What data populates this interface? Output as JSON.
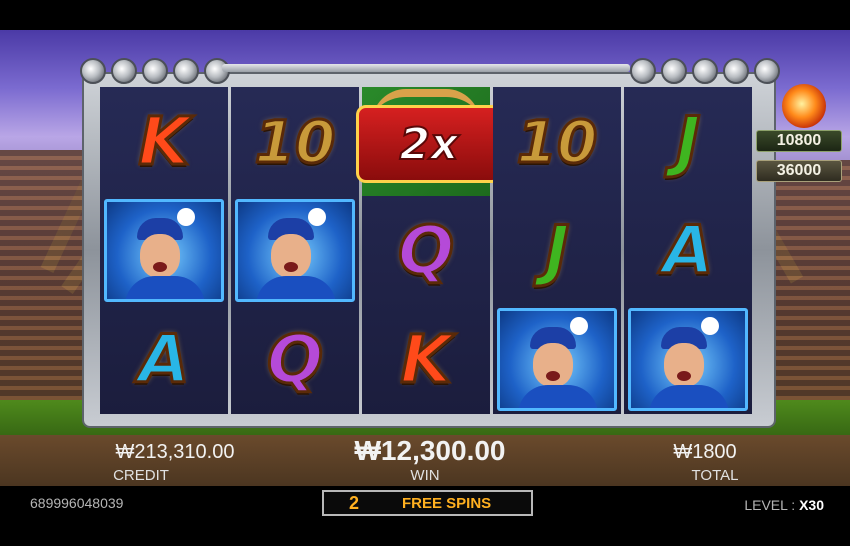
{
  "reels": [
    {
      "symbols": [
        "K",
        "player",
        "A"
      ]
    },
    {
      "symbols": [
        "10",
        "player",
        "Q"
      ]
    },
    {
      "symbols": [
        "multiplier",
        "Q",
        "K"
      ]
    },
    {
      "symbols": [
        "10",
        "J",
        "player"
      ]
    },
    {
      "symbols": [
        "J",
        "A",
        "player"
      ]
    }
  ],
  "multiplier": {
    "label": "2x"
  },
  "jackpots": {
    "top": "10800",
    "second": "36000"
  },
  "hud": {
    "credit_value": "₩213,310.00",
    "credit_label": "CREDIT",
    "win_value": "₩12,300.00",
    "win_label": "WIN",
    "total_value": "₩1800",
    "total_label": "TOTAL"
  },
  "footer": {
    "round_id": "689996048039",
    "free_spins_count": "2",
    "free_spins_label": "FREE SPINS",
    "level_label": "LEVEL :",
    "level_value": "X30"
  },
  "icons": [
    "fireball-icon",
    "baseball-player-icon",
    "multiplier-bats-icon"
  ],
  "colors": {
    "accent": "#ffb020",
    "frame": "#9aa0a7",
    "player_border": "#52b8ff"
  }
}
